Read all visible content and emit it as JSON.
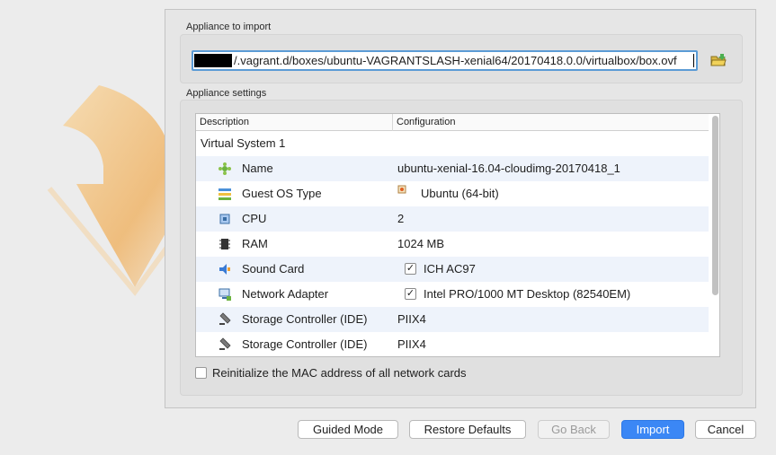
{
  "appliance_to_import": {
    "group_label": "Appliance to import",
    "path_value": "/.vagrant.d/boxes/ubuntu-VAGRANTSLASH-xenial64/20170418.0.0/virtualbox/box.ovf",
    "folder_button_icon": "open-folder-icon"
  },
  "appliance_settings": {
    "group_label": "Appliance settings",
    "columns": {
      "description": "Description",
      "configuration": "Configuration"
    },
    "system_label": "Virtual System 1",
    "rows": [
      {
        "icon": "name-icon",
        "description": "Name",
        "configuration": "ubuntu-xenial-16.04-cloudimg-20170418_1"
      },
      {
        "icon": "guest-os-icon",
        "description": "Guest OS Type",
        "configuration": "Ubuntu (64-bit)"
      },
      {
        "icon": "cpu-icon",
        "description": "CPU",
        "configuration": "2"
      },
      {
        "icon": "ram-icon",
        "description": "RAM",
        "configuration": "1024 MB"
      },
      {
        "icon": "sound-card-icon",
        "description": "Sound Card",
        "configuration": "ICH AC97",
        "checked": true
      },
      {
        "icon": "network-adapter-icon",
        "description": "Network Adapter",
        "configuration": "Intel PRO/1000 MT Desktop (82540EM)",
        "checked": true
      },
      {
        "icon": "storage-controller-icon",
        "description": "Storage Controller (IDE)",
        "configuration": "PIIX4"
      },
      {
        "icon": "storage-controller-icon",
        "description": "Storage Controller (IDE)",
        "configuration": "PIIX4"
      }
    ],
    "reinit_mac_label": "Reinitialize the MAC address of all network cards",
    "reinit_mac_checked": false
  },
  "buttons": {
    "guided_mode": "Guided Mode",
    "restore_defaults": "Restore Defaults",
    "go_back": "Go Back",
    "import": "Import",
    "cancel": "Cancel"
  },
  "colors": {
    "accent": "#3b87f5",
    "focus_ring": "#5b9bd5",
    "alt_row": "#eef3fb"
  }
}
